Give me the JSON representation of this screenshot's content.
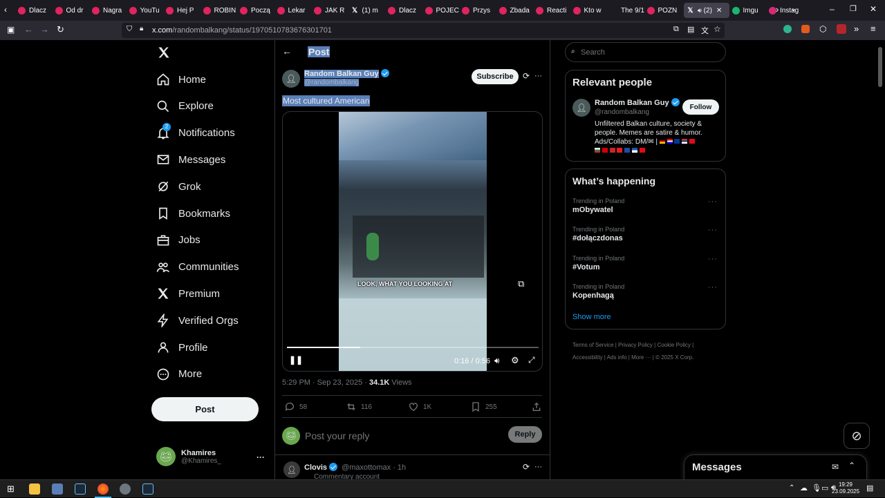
{
  "browser": {
    "tabs": [
      {
        "label": "Dlacz",
        "color": "#e0245e"
      },
      {
        "label": "Od dr",
        "color": "#e0245e"
      },
      {
        "label": "Nagra",
        "color": "#e0245e"
      },
      {
        "label": "YouTu",
        "color": "#e0245e"
      },
      {
        "label": "Hej P",
        "color": "#e0245e"
      },
      {
        "label": "ROBIN",
        "color": "#e0245e"
      },
      {
        "label": "Począ",
        "color": "#e0245e"
      },
      {
        "label": "Lekar",
        "color": "#e0245e"
      },
      {
        "label": "JAK R",
        "color": "#e0245e"
      },
      {
        "label": "(1) m",
        "color": "#ffffff"
      },
      {
        "label": "Dlacz",
        "color": "#e0245e"
      },
      {
        "label": "POJEC",
        "color": "#e0245e"
      },
      {
        "label": "Przys",
        "color": "#e0245e"
      },
      {
        "label": "Zbada",
        "color": "#e0245e"
      },
      {
        "label": "Reacti",
        "color": "#e0245e"
      },
      {
        "label": "Kto w",
        "color": "#e0245e"
      },
      {
        "label": "The 9/11 F",
        "color": "#1c1b22"
      },
      {
        "label": "POZN",
        "color": "#e0245e"
      },
      {
        "label": "(2) ",
        "color": "#ffffff",
        "active": true
      },
      {
        "label": "Imgu",
        "color": "#1bb76e"
      },
      {
        "label": "Instag",
        "color": "#d62976"
      }
    ],
    "url_domain": "x.com",
    "url_path": "/randombalkang/status/1970510783676301701"
  },
  "nav": {
    "items": [
      {
        "label": "Home",
        "icon": "home-icon"
      },
      {
        "label": "Explore",
        "icon": "search-icon"
      },
      {
        "label": "Notifications",
        "icon": "bell-icon",
        "badge": "2"
      },
      {
        "label": "Messages",
        "icon": "mail-icon"
      },
      {
        "label": "Grok",
        "icon": "grok-icon"
      },
      {
        "label": "Bookmarks",
        "icon": "bookmark-icon"
      },
      {
        "label": "Jobs",
        "icon": "briefcase-icon"
      },
      {
        "label": "Communities",
        "icon": "people-icon"
      },
      {
        "label": "Premium",
        "icon": "x-logo-icon"
      },
      {
        "label": "Verified Orgs",
        "icon": "lightning-icon"
      },
      {
        "label": "Profile",
        "icon": "person-icon"
      },
      {
        "label": "More",
        "icon": "more-circle-icon"
      }
    ],
    "post_button": "Post",
    "account": {
      "name": "Khamires",
      "handle": "@Khamires_"
    }
  },
  "post": {
    "header_title": "Post",
    "author_name": "Random Balkan Guy",
    "author_handle": "@randombalkang",
    "subscribe": "Subscribe",
    "text": "Most cultured American",
    "video": {
      "caption": "LOOK, WHAT YOU LOOKING AT",
      "time": "0:16 / 0:56",
      "progress": 0.29
    },
    "timestamp": "5:29 PM · Sep 23, 2025 · ",
    "views_count": "34.1K",
    "views_label": " Views",
    "replies": "58",
    "reposts": "116",
    "likes": "1K",
    "bookmarks": "255",
    "reply_placeholder": "Post your reply",
    "reply_button": "Reply"
  },
  "reply_preview": {
    "name": "Clovis",
    "handle": "@maxottomax · 1h",
    "bio": "Commentary account"
  },
  "sidebar": {
    "search_placeholder": "Search",
    "relevant_title": "Relevant people",
    "person": {
      "name": "Random Balkan Guy",
      "handle": "@randombalkang",
      "follow": "Follow",
      "bio": "Unfiltered Balkan culture, society & people. Memes are satire & humor. Ads/Collabs: DM/✉ |"
    },
    "happening_title": "What’s happening",
    "trends": [
      {
        "category": "Trending in Poland",
        "name": "mObywatel"
      },
      {
        "category": "Trending in Poland",
        "name": "#dołączdonas"
      },
      {
        "category": "Trending in Poland",
        "name": "#Votum"
      },
      {
        "category": "Trending in Poland",
        "name": "Kopenhagą"
      }
    ],
    "show_more": "Show more",
    "footer": [
      "Terms of Service",
      "Privacy Policy",
      "Cookie Policy",
      "Accessibility",
      "Ads info",
      "More ···",
      "© 2025 X Corp."
    ]
  },
  "messages_dock": {
    "title": "Messages"
  },
  "taskbar": {
    "time": "19:29",
    "date": "23.09.2025"
  }
}
